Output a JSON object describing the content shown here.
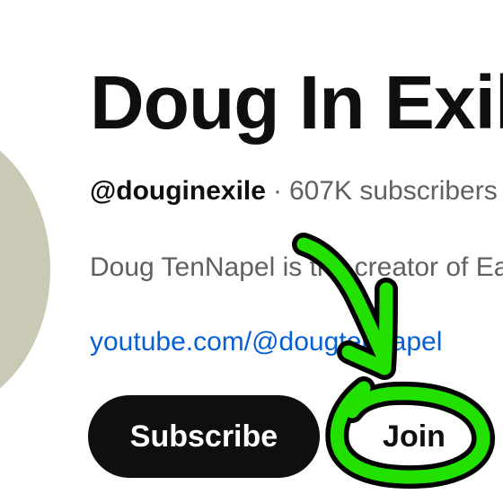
{
  "channel": {
    "title": "Doug In Exile",
    "handle": "@douginexile",
    "separator": "·",
    "subscribers": "607K subscribers",
    "description": "Doug TenNapel is the creator of Earthworm Jim",
    "link": "youtube.com/@dougtennapel"
  },
  "actions": {
    "subscribe_label": "Subscribe",
    "join_label": "Join"
  },
  "annotation": {
    "icon": "hand-drawn-arrow-and-circle",
    "color": "#22e000"
  },
  "colors": {
    "avatar": "#c9c9b6",
    "text_primary": "#0f0f0f",
    "text_secondary": "#606060",
    "link": "#065fd4",
    "subscribe_bg": "#0f0f0f"
  }
}
